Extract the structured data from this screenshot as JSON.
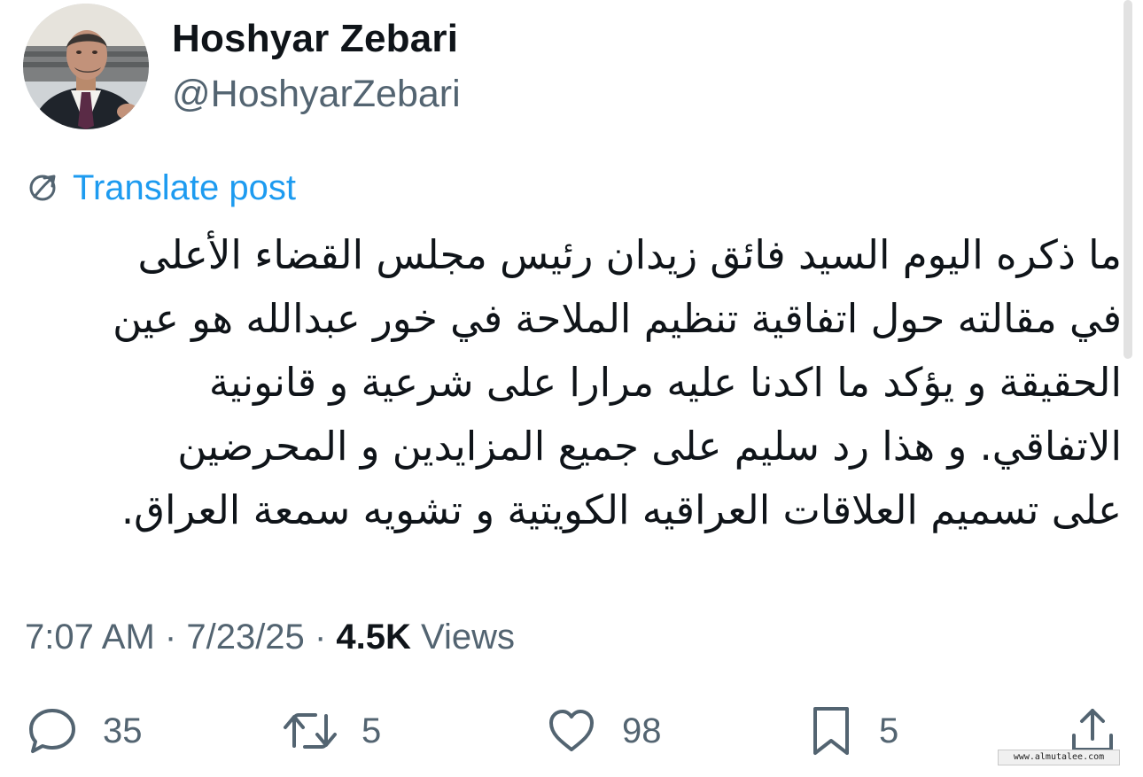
{
  "author": {
    "display_name": "Hoshyar Zebari",
    "handle": "@HoshyarZebari",
    "avatar_icon": "profile-photo"
  },
  "translate": {
    "label": "Translate post",
    "icon": "globe-translate-icon"
  },
  "tweet": {
    "lines": [
      "ما ذكره اليوم السيد فائق زيدان رئيس مجلس القضاء الأعلى",
      "في مقالته حول اتفاقية تنظيم الملاحة في خور عبدالله هو عين",
      "الحقيقة و يؤكد ما اكدنا عليه مرارا على شرعية و قانونية",
      "الاتفاقي. و هذا رد سليم على جميع المزايدين و المحرضين",
      "على تسميم العلاقات العراقيه الكويتية و تشويه سمعة العراق."
    ]
  },
  "meta": {
    "time": "7:07 AM",
    "date": "7/23/25",
    "separator": "·",
    "views_count": "4.5K",
    "views_label": "Views"
  },
  "actions": {
    "reply_count": "35",
    "repost_count": "5",
    "like_count": "98",
    "bookmark_count": "5"
  },
  "watermark": {
    "text": "www.almutalee.com"
  },
  "colors": {
    "link": "#1d9bf0",
    "secondary_text": "#536471",
    "primary_text": "#0f1419",
    "background": "#ffffff"
  }
}
